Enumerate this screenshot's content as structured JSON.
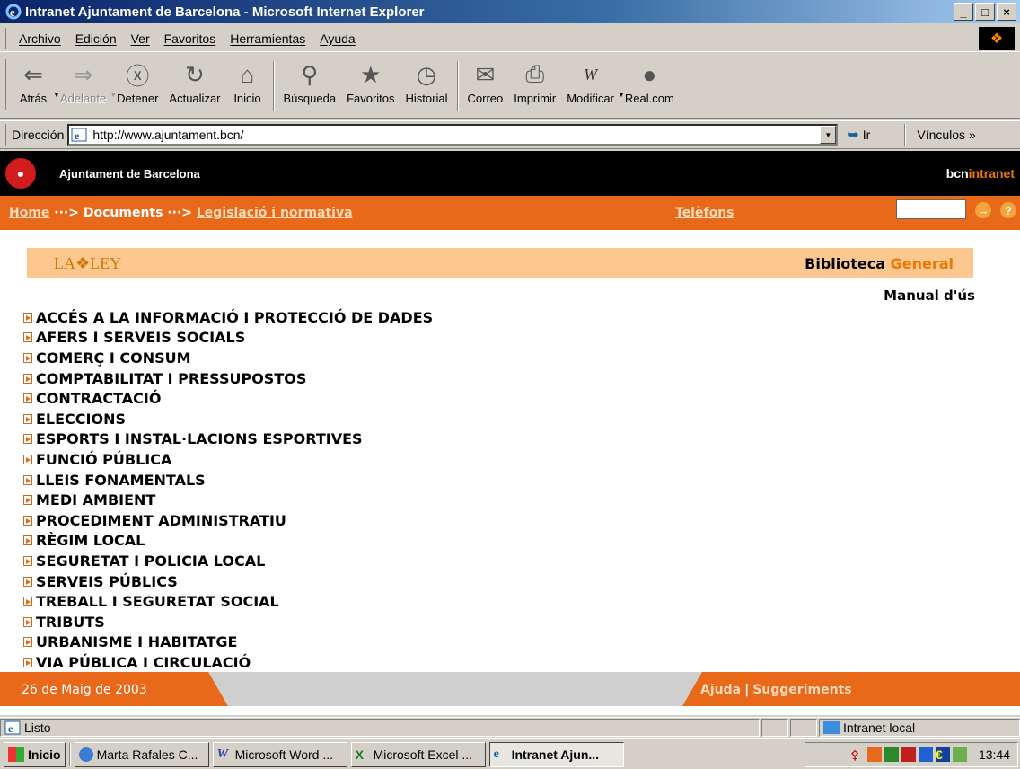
{
  "window": {
    "title": "Intranet Ajuntament de Barcelona - Microsoft Internet Explorer",
    "minimize": "_",
    "maximize": "□",
    "close": "×"
  },
  "menu": [
    "Archivo",
    "Edición",
    "Ver",
    "Favoritos",
    "Herramientas",
    "Ayuda"
  ],
  "toolbar": {
    "back": "Atrás",
    "forward": "Adelante",
    "stop": "Detener",
    "refresh": "Actualizar",
    "home": "Inicio",
    "search": "Búsqueda",
    "favorites": "Favoritos",
    "history": "Historial",
    "mail": "Correo",
    "print": "Imprimir",
    "edit": "Modificar",
    "real": "Real.com"
  },
  "address": {
    "label": "Dirección",
    "url": "http://www.ajuntament.bcn/",
    "go": "Ir",
    "links": "Vínculos »"
  },
  "site": {
    "org": "Ajuntament de Barcelona",
    "brand_a": "bcn",
    "brand_b": "intranet",
    "crumb_home": "Home",
    "crumb_sep1": " ···> ",
    "crumb_docs": "Documents",
    "crumb_sep2": " ···> ",
    "crumb_leg": "Legislació i normativa",
    "phones": "Telèfons",
    "search_value": "",
    "go_btn": "→",
    "help_btn": "?",
    "laley": "LA❖LEY",
    "biblio_a": "Biblioteca ",
    "biblio_b": "General",
    "manual": "Manual d'ús",
    "categories": [
      "ACCÉS A LA INFORMACIÓ I PROTECCIÓ DE DADES",
      "AFERS I SERVEIS SOCIALS",
      "COMERÇ I CONSUM",
      "COMPTABILITAT I PRESSUPOSTOS",
      "CONTRACTACIÓ",
      "ELECCIONS",
      "ESPORTS I INSTAL·LACIONS ESPORTIVES",
      "FUNCIÓ PÚBLICA",
      "LLEIS FONAMENTALS",
      "MEDI AMBIENT",
      "PROCEDIMENT ADMINISTRATIU",
      "RÈGIM LOCAL",
      "SEGURETAT I POLICIA LOCAL",
      "SERVEIS PÚBLICS",
      "TREBALL I SEGURETAT SOCIAL",
      "TRIBUTS",
      "URBANISME I HABITATGE",
      "VIA PÚBLICA I CIRCULACIÓ"
    ],
    "date": "26 de Maig de 2003",
    "help_link": "Ajuda",
    "sep": "|",
    "suggest_link": "Suggeriments"
  },
  "status": {
    "text": "Listo",
    "zone": "Intranet local"
  },
  "taskbar": {
    "start": "Inicio",
    "tasks": [
      "Marta Rafales C...",
      "Microsoft Word ...",
      "Microsoft Excel ...",
      "Intranet Ajun..."
    ],
    "clock": "13:44"
  },
  "colors": {
    "accent_orange": "#e8691a",
    "header_black": "#000000",
    "biblio_band": "#fcc890"
  }
}
